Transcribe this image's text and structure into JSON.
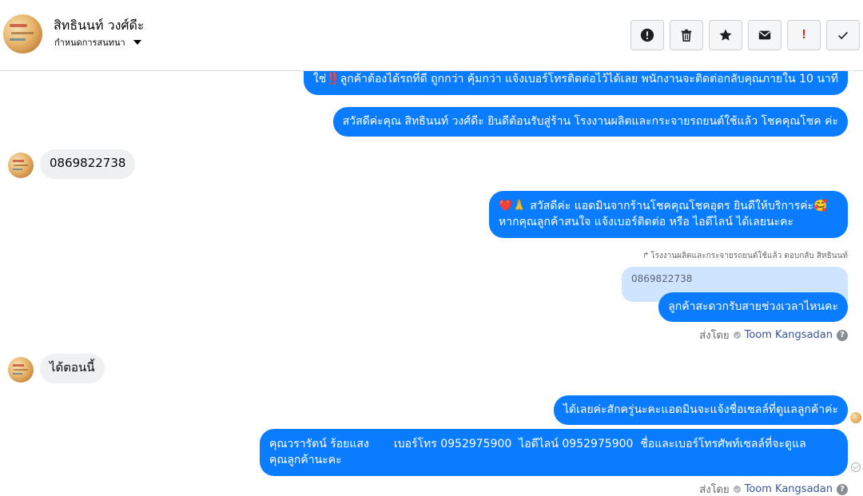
{
  "header": {
    "contact_name": "สิทธินนท์ วงศ์ดีะ",
    "subtitle": "กำหนดการสนทนา",
    "avatar_icon": "profile-avatar"
  },
  "toolbar": {
    "buttons": [
      {
        "name": "report-button",
        "icon": "exclamation-circle-icon"
      },
      {
        "name": "delete-button",
        "icon": "trash-icon"
      },
      {
        "name": "star-button",
        "icon": "star-icon"
      },
      {
        "name": "mark-unread-button",
        "icon": "envelope-icon"
      },
      {
        "name": "follow-up-button",
        "icon": "exclamation-icon",
        "label": "!"
      },
      {
        "name": "mark-done-button",
        "icon": "check-icon"
      }
    ]
  },
  "messages": {
    "m1": "ใช่‼️ลูกค้าต้องได้รถที่ดี ถูกกว่า คุ้มกว่า แจ้งเบอร์โทรติดต่อไว้ได้เลย พนักงานจะติดต่อกลับคุณภายใน 10 นาที",
    "m2": "สวัสดีค่ะคุณ สิทธินนท์ วงศ์ดีะ ยินดีต้อนรับสู่ร้าน โรงงานผลิตและกระจายรถยนต์ใช้แล้ว โชคคุณโชค ค่ะ",
    "m3": "0869822738",
    "m4_line1": "❤️🙏 สวัสดีค่ะ แอดมินจากร้านโชคคุณโชคอุดร ยินดีให้บริการค่ะ🥰",
    "m4_line2": "หากคุณลูกค้าสนใจ แจ้งเบอร์ติดต่อ หรือ ไอดีไลน์ ได้เลยนะคะ",
    "reply_meta": "โรงงานผลิตและกระจายรถยนต์ใช้แล้ว ตอบกลับ สิทธินนท์",
    "quoted": "0869822738",
    "m5": "ลูกค้าสะดวกรับสายช่วงเวลาไหนคะ",
    "sent_by_label": "ส่งโดย",
    "sent_by_name": "Toom Kangsadan",
    "m6": "ได้ตอนนี้",
    "m7": "ได้เลยค่ะสักครู่นะคะแอดมินจะแจ้งชื่อเซลล์ที่ดูแลลูกค้าค่ะ",
    "m8_line1": "คุณวรารัตน์ ร้อยแสง       เบอร์โทร 0952975900  ไอดีไลน์ 0952975900  ชื่อและเบอร์โทรศัพท์เซลล์ที่จะดูแล",
    "m8_line2": "คุณลูกค้านะคะ",
    "sent_by_label2": "ส่งโดย",
    "sent_by_name2": "Toom Kangsadan",
    "help_icon": "?"
  },
  "colors": {
    "outgoing_bubble": "#0a7cff",
    "incoming_bubble": "#eef0f2",
    "follow_up_accent": "#e02020"
  }
}
